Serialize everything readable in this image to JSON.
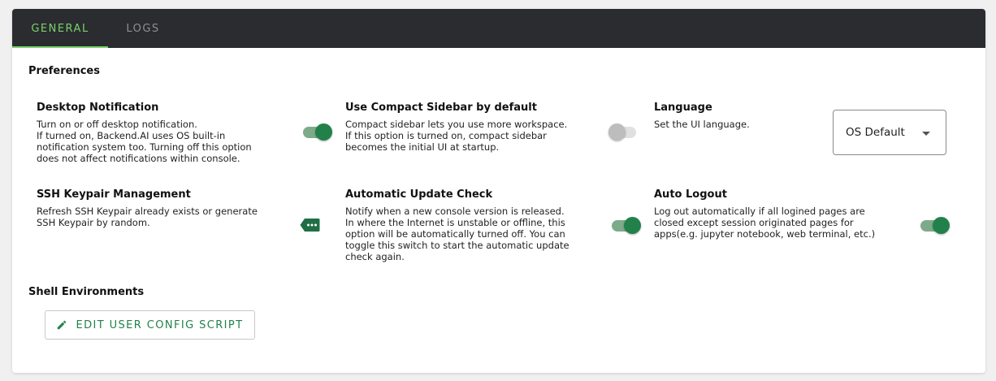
{
  "tabs": [
    {
      "label": "GENERAL",
      "active": true
    },
    {
      "label": "LOGS",
      "active": false
    }
  ],
  "sections": {
    "preferences": "Preferences",
    "shell": "Shell Environments"
  },
  "settings": {
    "desktop_notification": {
      "title": "Desktop Notification",
      "desc": [
        "Turn on or off desktop notification.",
        "If turned on, Backend.AI uses OS built-in",
        "notification system too. Turning off this option",
        "does not affect notifications within console."
      ],
      "enabled": true
    },
    "compact_sidebar": {
      "title": "Use Compact Sidebar by default",
      "desc": [
        "Compact sidebar lets you use more workspace.",
        "If this option is turned on, compact sidebar",
        "becomes the initial UI at startup."
      ],
      "enabled": false
    },
    "language": {
      "title": "Language",
      "desc": [
        "Set the UI language."
      ],
      "selected": "OS Default"
    },
    "ssh_keypair": {
      "title": "SSH Keypair Management",
      "desc": [
        "Refresh SSH Keypair already exists or generate",
        "SSH Keypair by random."
      ],
      "icon": "more-tag-icon"
    },
    "update_check": {
      "title": "Automatic Update Check",
      "desc": [
        "Notify when a new console version is released.",
        "In where the Internet is unstable or offline, this",
        "option will be automatically turned off. You can",
        "toggle this switch to start the automatic update",
        "check again."
      ],
      "enabled": true
    },
    "auto_logout": {
      "title": "Auto Logout",
      "desc": [
        "Log out automatically if all logined pages are",
        "closed except session originated pages for",
        "apps(e.g. jupyter notebook, web terminal, etc.)"
      ],
      "enabled": true
    }
  },
  "shell": {
    "edit_button": "EDIT USER CONFIG SCRIPT",
    "icon": "pencil-icon"
  },
  "colors": {
    "accent_tab": "#7ad16a",
    "switch_on": "#22814a",
    "tabbar_bg": "#2a2c30"
  }
}
